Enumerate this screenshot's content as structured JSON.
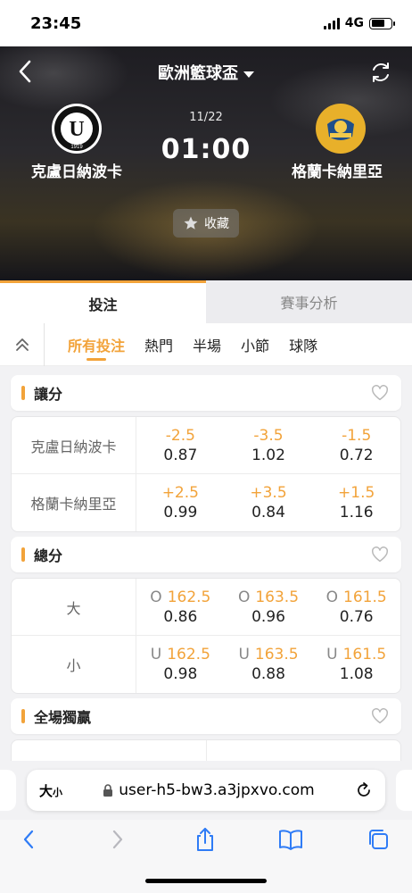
{
  "status_bar": {
    "time": "23:45",
    "network": "4G"
  },
  "header": {
    "league_title": "歐洲籃球盃",
    "match_date": "11/22",
    "match_time": "01:00",
    "home_team": "克盧日納波卡",
    "away_team": "格蘭卡納里亞",
    "home_logo_text": "U",
    "home_logo_year": "1919",
    "favorite_label": "收藏"
  },
  "main_tabs": [
    {
      "label": "投注",
      "active": true
    },
    {
      "label": "賽事分析",
      "active": false
    }
  ],
  "sub_tabs": [
    {
      "label": "所有投注",
      "active": true
    },
    {
      "label": "熱門",
      "active": false
    },
    {
      "label": "半場",
      "active": false
    },
    {
      "label": "小節",
      "active": false
    },
    {
      "label": "球隊",
      "active": false
    }
  ],
  "sections": {
    "handicap": {
      "title": "讓分",
      "rows": [
        {
          "label": "克盧日納波卡",
          "cells": [
            {
              "line": "-2.5",
              "odds": "0.87"
            },
            {
              "line": "-3.5",
              "odds": "1.02"
            },
            {
              "line": "-1.5",
              "odds": "0.72"
            }
          ]
        },
        {
          "label": "格蘭卡納里亞",
          "cells": [
            {
              "line": "+2.5",
              "odds": "0.99"
            },
            {
              "line": "+3.5",
              "odds": "0.84"
            },
            {
              "line": "+1.5",
              "odds": "1.16"
            }
          ]
        }
      ]
    },
    "total": {
      "title": "總分",
      "rows": [
        {
          "label": "大",
          "cells": [
            {
              "prefix": "O",
              "line": "162.5",
              "odds": "0.86"
            },
            {
              "prefix": "O",
              "line": "163.5",
              "odds": "0.96"
            },
            {
              "prefix": "O",
              "line": "161.5",
              "odds": "0.76"
            }
          ]
        },
        {
          "label": "小",
          "cells": [
            {
              "prefix": "U",
              "line": "162.5",
              "odds": "0.98"
            },
            {
              "prefix": "U",
              "line": "163.5",
              "odds": "0.88"
            },
            {
              "prefix": "U",
              "line": "161.5",
              "odds": "1.08"
            }
          ]
        }
      ]
    },
    "moneyline": {
      "title": "全場獨贏"
    }
  },
  "browser": {
    "text_size_label": "大",
    "text_size_small": "小",
    "url": "user-h5-bw3.a3jpxvo.com"
  },
  "colors": {
    "accent": "#f2a33a",
    "ios_blue": "#2f7cf6"
  }
}
